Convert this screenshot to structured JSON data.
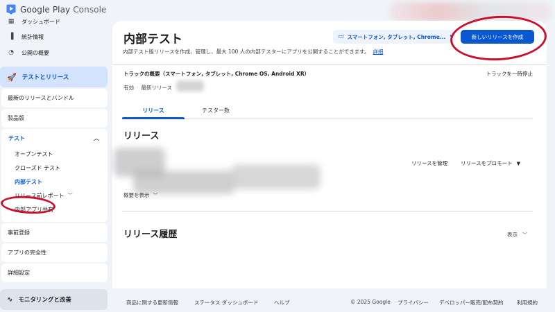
{
  "header": {
    "logo_text_a": "Google Play",
    "logo_text_b": "Console"
  },
  "sidebar": {
    "top_items": [
      {
        "label": "ダッシュボード",
        "icon": "dashboard-icon"
      },
      {
        "label": "統計情報",
        "icon": "bar-chart-icon"
      },
      {
        "label": "公開の概要",
        "icon": "publishing-overview-icon"
      }
    ],
    "section_label": "テストとリリース",
    "latest_releases": "最新のリリースとバンドル",
    "production": "製品版",
    "testing": {
      "label": "テスト",
      "items": [
        "オープンテスト",
        "クローズド テスト",
        "内部テスト",
        "リリース前レポート",
        "内部アプリ共有"
      ]
    },
    "pre_registration": "事前登録",
    "app_integrity": "アプリの完全性",
    "advanced_settings": "詳細設定",
    "monitoring": "モニタリングと改善"
  },
  "main": {
    "title": "内部テスト",
    "description": "内部テスト版リリースを作成、管理し、最大 100 人の内部テスターにアプリを公開することができます。",
    "details_link": "詳細",
    "device_select": "スマートフォン, タブレット, Chrome...",
    "create_button": "新しいリリースを作成",
    "track_overview": "トラックの概要（スマートフォン, タブレット, Chrome OS, Android XR）",
    "pause_track": "トラックを一時停止",
    "status_active": "有効",
    "latest_release": "最新リリース",
    "tabs": [
      "リリース",
      "テスター数"
    ],
    "releases_title": "リリース",
    "manage_release": "リリースを管理",
    "promote_release": "リリースをプロモート",
    "show_summary": "概要を表示",
    "history_title": "リリース履歴",
    "display_label": "表示"
  },
  "footer": {
    "left_links": [
      "商品に関する更新情報",
      "ステータス ダッシュボード",
      "ヘルプ"
    ],
    "copyright": "© 2025 Google",
    "right_links": [
      "プライバシー",
      "デベロッパー販売/配布契約",
      "利用規約"
    ]
  },
  "colors": {
    "accent": "#0b57d0",
    "annotation": "#c8102e"
  }
}
